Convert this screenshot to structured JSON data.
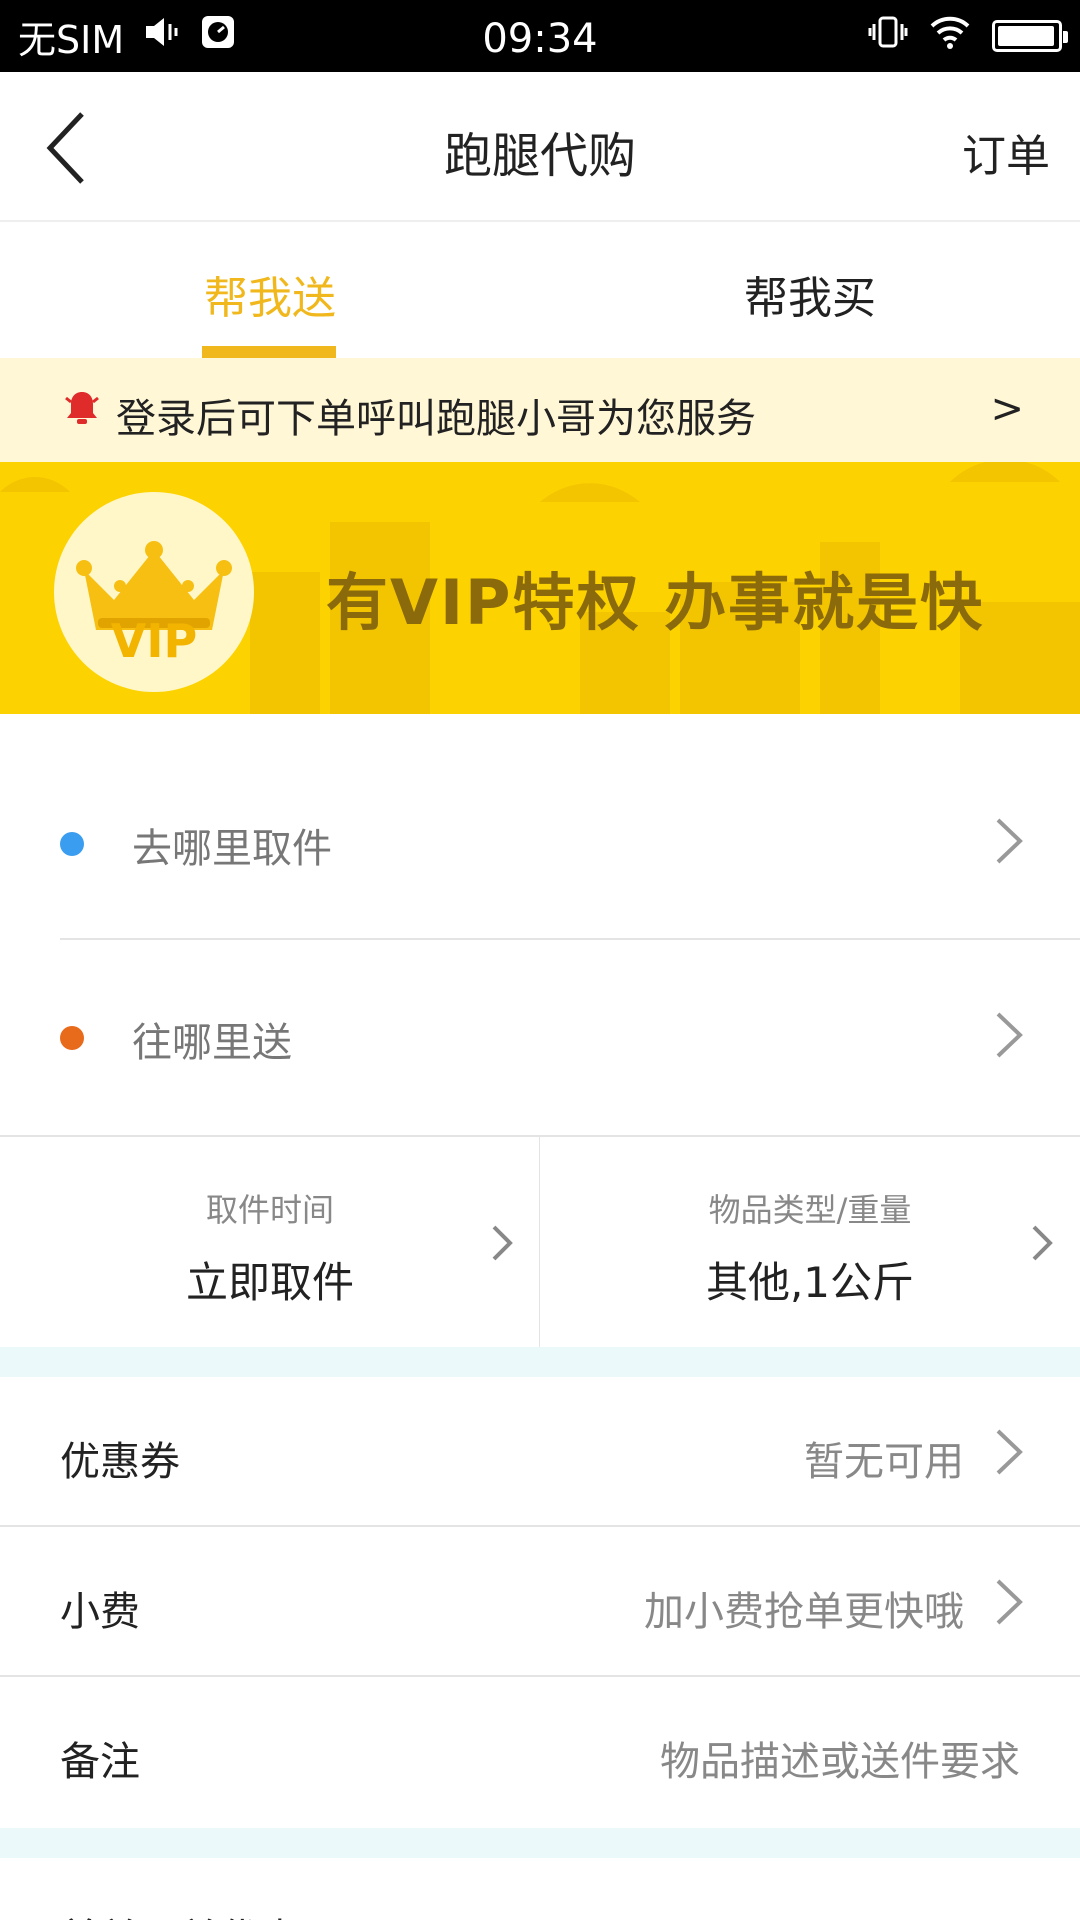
{
  "status": {
    "carrier": "无SIM",
    "time": "09:34"
  },
  "header": {
    "title": "跑腿代购",
    "orders": "订单"
  },
  "tabs": [
    {
      "label": "帮我送"
    },
    {
      "label": "帮我买"
    }
  ],
  "notice": {
    "text": "登录后可下单呼叫跑腿小哥为您服务",
    "arrow": ">"
  },
  "banner": {
    "badge": "VIP",
    "slogan": "有VIP特权  办事就是快"
  },
  "address": {
    "pickup": {
      "label": "去哪里取件",
      "dot_color": "#3a9df0"
    },
    "dropoff": {
      "label": "往哪里送",
      "dot_color": "#e86a1b"
    }
  },
  "options": {
    "time": {
      "caption": "取件时间",
      "value": "立即取件"
    },
    "item": {
      "caption": "物品类型/重量",
      "value": "其他,1公斤"
    }
  },
  "rows": {
    "coupon": {
      "label": "优惠券",
      "value": "暂无可用"
    },
    "tip": {
      "label": "小费",
      "value": "加小费抢单更快哦"
    },
    "note": {
      "label": "备注",
      "value": "物品描述或送件要求"
    }
  },
  "bottom": {
    "label": "首单下单优惠"
  },
  "colors": {
    "accent": "#f0b81d",
    "banner": "#fcd200",
    "notice_bg": "#fff7d6",
    "gap": "#ecf9fb"
  }
}
